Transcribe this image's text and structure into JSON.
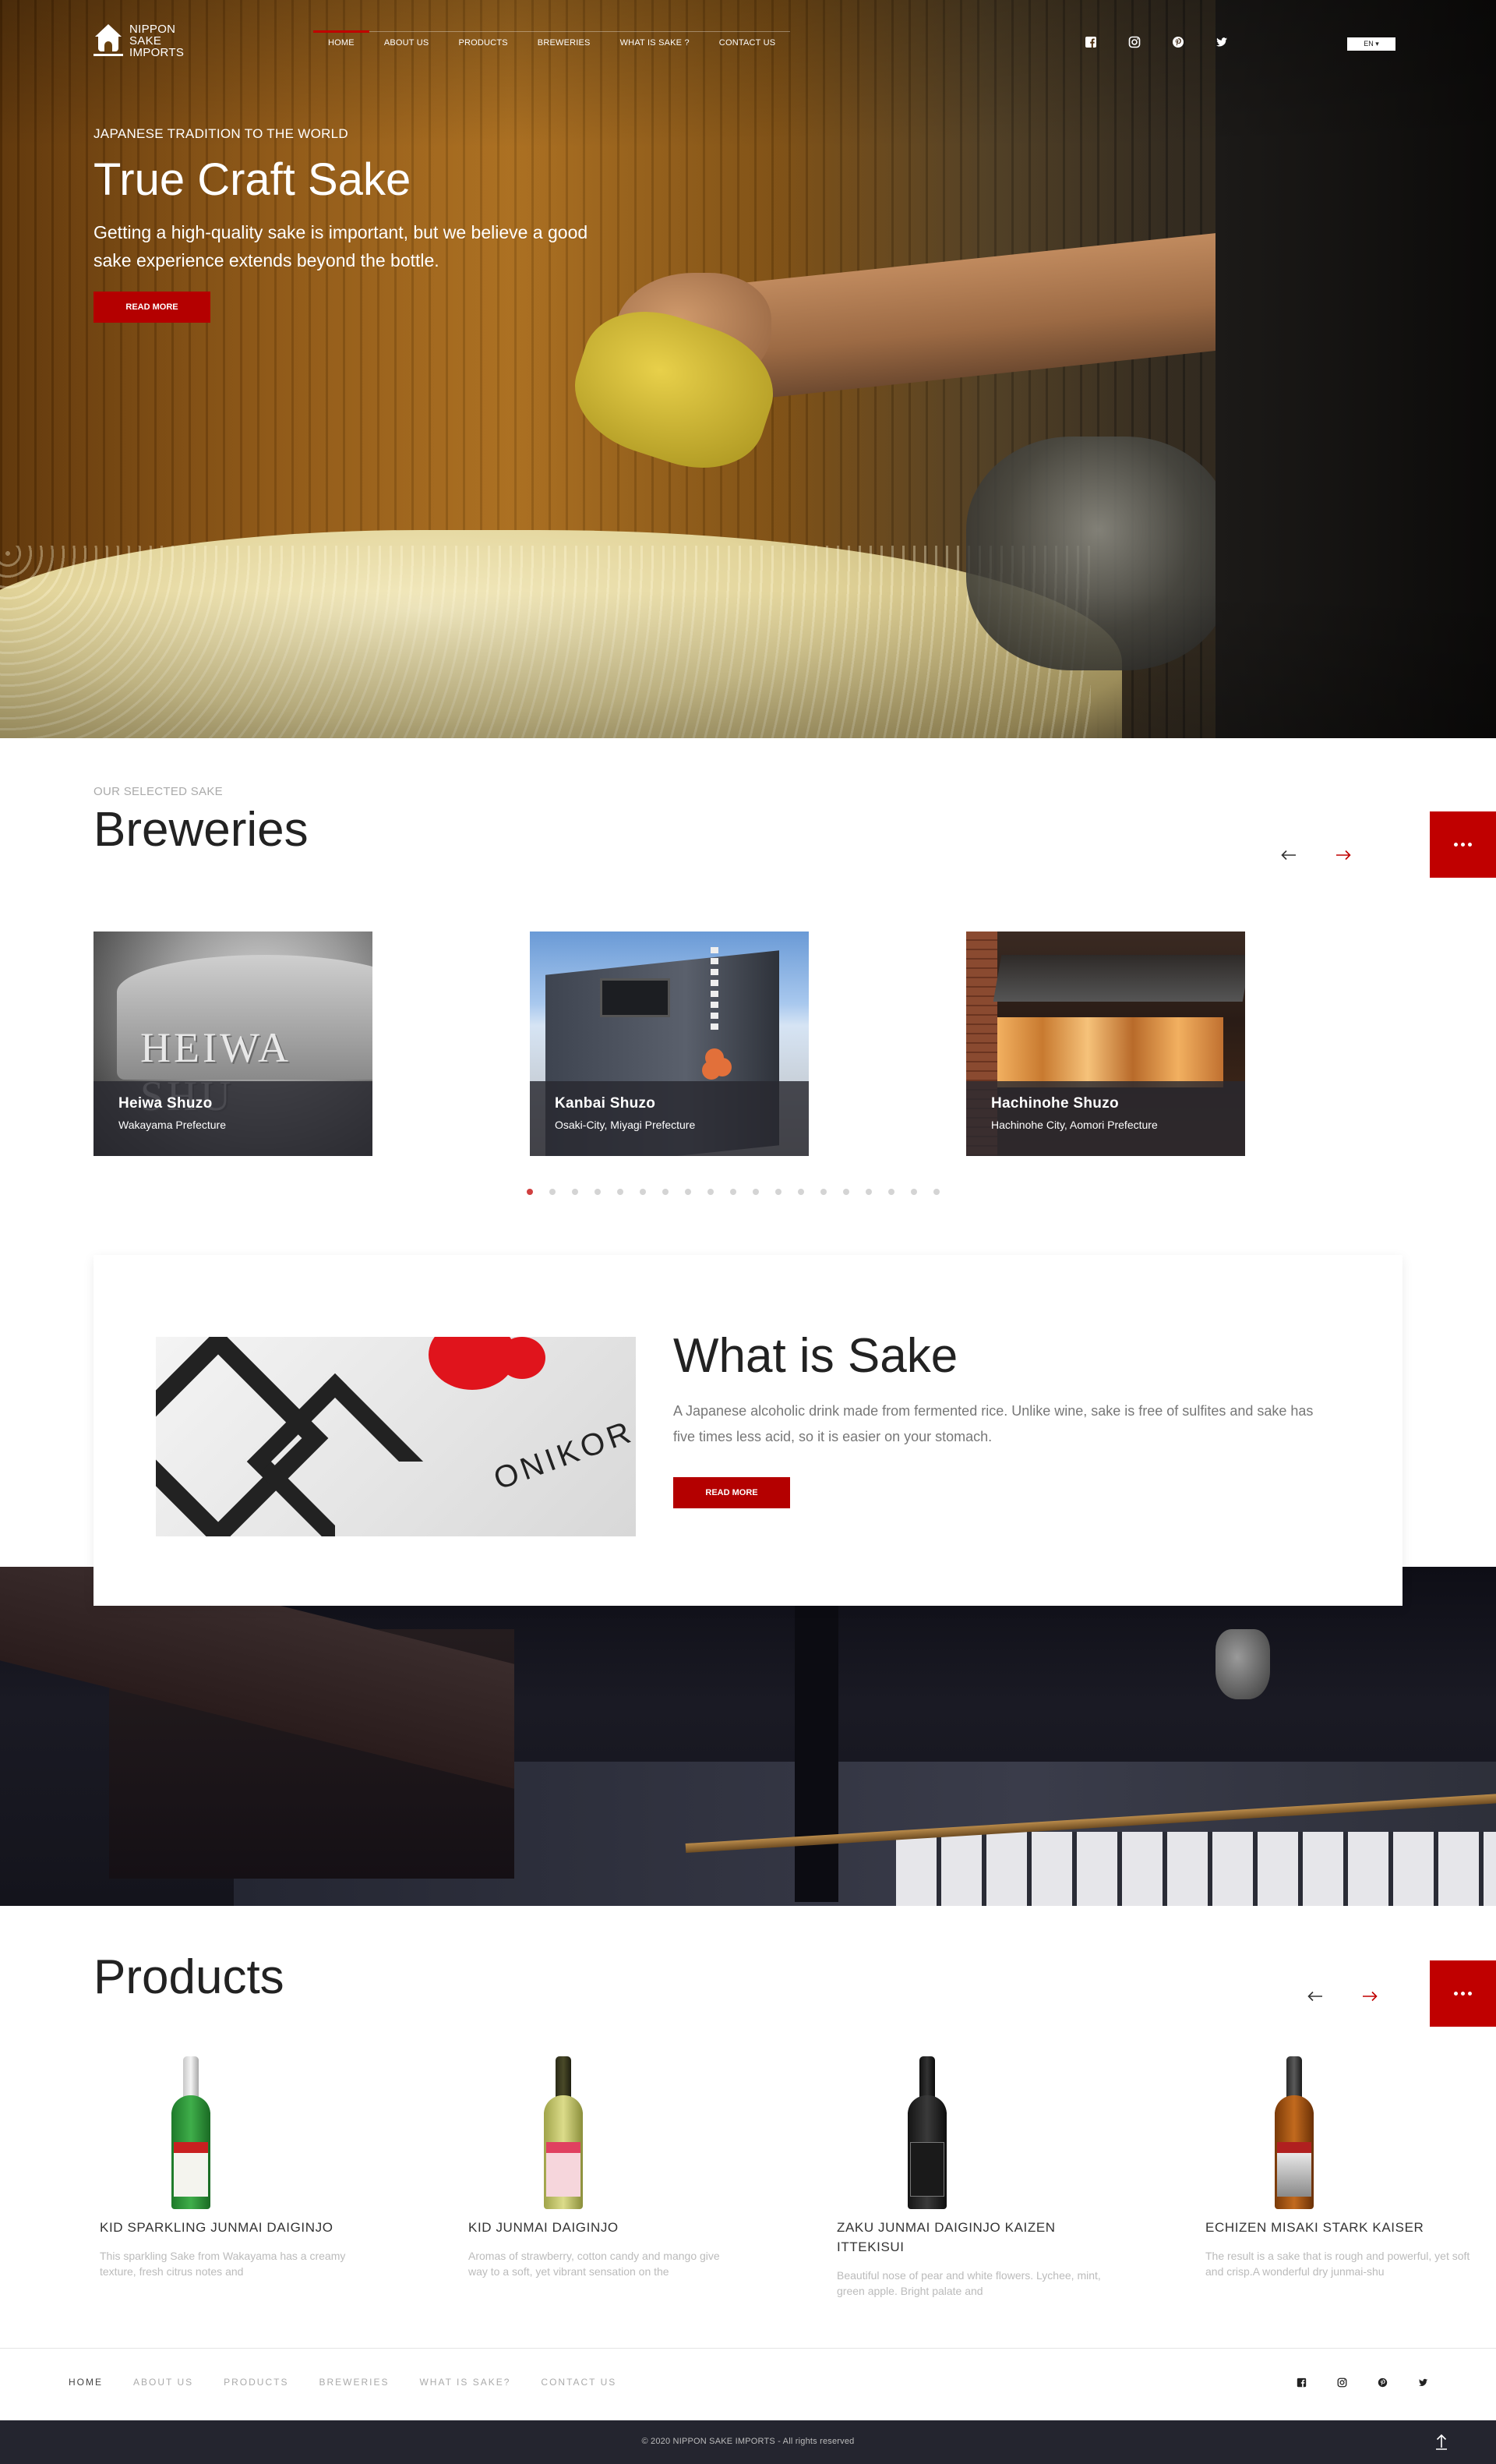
{
  "brand": {
    "logo_lines": [
      "NIPPON",
      "SAKE",
      "IMPORTS"
    ],
    "accent_color": "#c00000",
    "dark_color": "#24252f"
  },
  "nav": {
    "items": [
      {
        "label": "HOME",
        "active": true
      },
      {
        "label": "ABOUT US"
      },
      {
        "label": "PRODUCTS"
      },
      {
        "label": "BREWERIES"
      },
      {
        "label": "WHAT IS SAKE ?"
      },
      {
        "label": "CONTACT US"
      }
    ]
  },
  "social": {
    "icons": [
      "facebook-icon",
      "instagram-icon",
      "pinterest-icon",
      "twitter-icon"
    ]
  },
  "language": {
    "selected": "EN ▾"
  },
  "hero": {
    "kicker": "JAPANESE TRADITION TO THE WORLD",
    "title": "True Craft Sake",
    "text": "Getting a high-quality sake is important, but we believe a good sake experience extends beyond the bottle.",
    "button": "READ MORE"
  },
  "breweries": {
    "kicker": "OUR SELECTED SAKE",
    "title": "Breweries",
    "cards": [
      {
        "name": "Heiwa Shuzo",
        "prefecture": "Wakayama Prefecture",
        "image_text": "HEIWA SHU"
      },
      {
        "name": "Kanbai Shuzo",
        "prefecture": "Osaki-City, Miyagi Prefecture"
      },
      {
        "name": "Hachinohe Shuzo",
        "prefecture": "Hachinohe City, Aomori Prefecture"
      }
    ],
    "pager": {
      "total": 19,
      "active": 1
    }
  },
  "what_is_sake": {
    "title": "What is Sake",
    "text": "A Japanese alcoholic drink made from fermented rice. Unlike wine, sake is free of sulfites and sake has five times less acid, so it is easier on your stomach.",
    "button": "READ MORE",
    "image_text": "ONIKOR"
  },
  "products": {
    "title": "Products",
    "items": [
      {
        "name": "KID SPARKLING JUNMAI DAIGINJO",
        "description": "This sparkling Sake from Wakayama has a creamy texture, fresh citrus notes and",
        "bottle": "green"
      },
      {
        "name": "KID JUNMAI DAIGINJO",
        "description": "Aromas of strawberry, cotton candy and mango give way to a soft, yet vibrant sensation on the",
        "bottle": "pale"
      },
      {
        "name": "ZAKU JUNMAI DAIGINJO KAIZEN ITTEKISUI",
        "description": "Beautiful nose of pear and white flowers. Lychee, mint, green apple. Bright palate and",
        "bottle": "black"
      },
      {
        "name": "ECHIZEN MISAKI STARK KAISER",
        "description": "The result is a sake that is rough and powerful, yet soft and crisp.A wonderful dry junmai-shu",
        "bottle": "amber"
      }
    ]
  },
  "footer": {
    "nav": [
      {
        "label": "HOME",
        "active": true
      },
      {
        "label": "ABOUT US"
      },
      {
        "label": "PRODUCTS"
      },
      {
        "label": "BREWERIES"
      },
      {
        "label": "WHAT IS SAKE?"
      },
      {
        "label": "CONTACT US"
      }
    ],
    "copyright": "© 2020 NIPPON SAKE IMPORTS - All rights reserved"
  }
}
